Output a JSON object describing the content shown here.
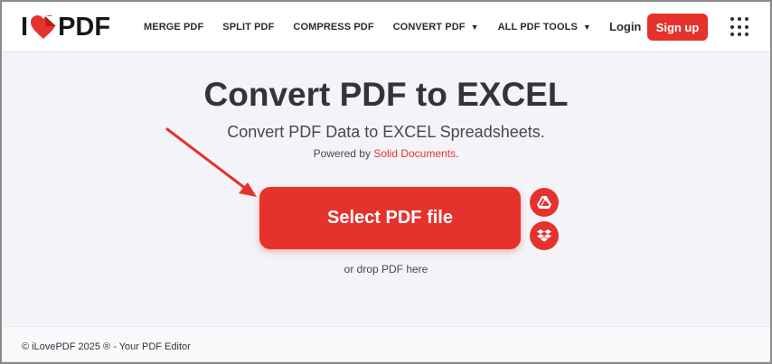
{
  "header": {
    "logo": {
      "prefix": "I",
      "suffix": "PDF",
      "icon": "heart-icon"
    },
    "nav": [
      {
        "label": "MERGE PDF",
        "has_dropdown": false
      },
      {
        "label": "SPLIT PDF",
        "has_dropdown": false
      },
      {
        "label": "COMPRESS PDF",
        "has_dropdown": false
      },
      {
        "label": "CONVERT PDF",
        "has_dropdown": true
      },
      {
        "label": "ALL PDF TOOLS",
        "has_dropdown": true
      }
    ],
    "login_label": "Login",
    "signup_label": "Sign up",
    "apps_icon": "grid-menu-icon"
  },
  "main": {
    "title": "Convert PDF to EXCEL",
    "subtitle": "Convert PDF Data to EXCEL Spreadsheets.",
    "powered_prefix": "Powered by ",
    "powered_link": "Solid Documents",
    "powered_suffix": ".",
    "select_button_label": "Select PDF file",
    "cloud_buttons": [
      "google-drive-icon",
      "dropbox-icon"
    ],
    "drop_text": "or drop PDF here"
  },
  "footer": {
    "text": "© iLovePDF 2025 ® - Your PDF Editor"
  },
  "colors": {
    "accent": "#e5322d",
    "text": "#33333b",
    "background": "#f4f3f8",
    "header_bg": "#ffffff"
  }
}
